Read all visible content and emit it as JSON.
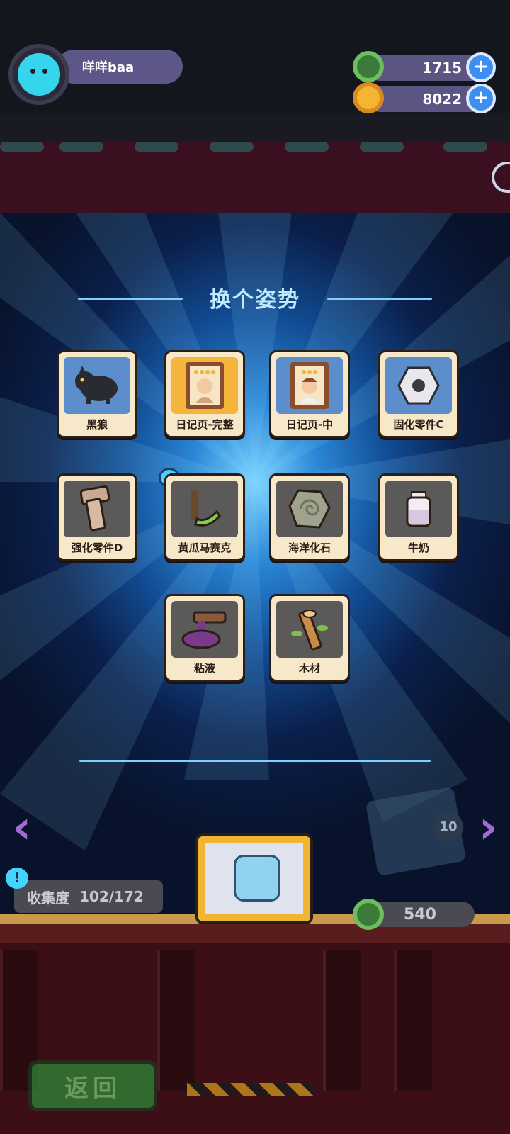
{
  "header": {
    "username": "咩咩baa",
    "currency_green": "1715",
    "currency_gold": "8022"
  },
  "title": "换个姿势",
  "items": [
    {
      "label": "黑狼",
      "icon": "black-wolf"
    },
    {
      "label": "日记页-完整",
      "icon": "diary-page-full"
    },
    {
      "label": "日记页-中",
      "icon": "diary-page-mid"
    },
    {
      "label": "固化零件C",
      "icon": "hex-nut"
    },
    {
      "label": "强化零件D",
      "icon": "bolt"
    },
    {
      "label": "黄瓜马赛克",
      "icon": "cucumber"
    },
    {
      "label": "海洋化石",
      "icon": "fossil"
    },
    {
      "label": "牛奶",
      "icon": "milk"
    },
    {
      "label": "粘液",
      "icon": "slime"
    },
    {
      "label": "木材",
      "icon": "wood"
    }
  ],
  "new_badge": "!",
  "collection": {
    "label": "收集度",
    "value": "102/172",
    "info": "!"
  },
  "box_price": "540",
  "ten_pack": "10",
  "back_button": "返回",
  "colors": {
    "card_bg": "#f6e8c8",
    "title": "#bfe9ff",
    "accent_blue": "#3c8ff0"
  }
}
